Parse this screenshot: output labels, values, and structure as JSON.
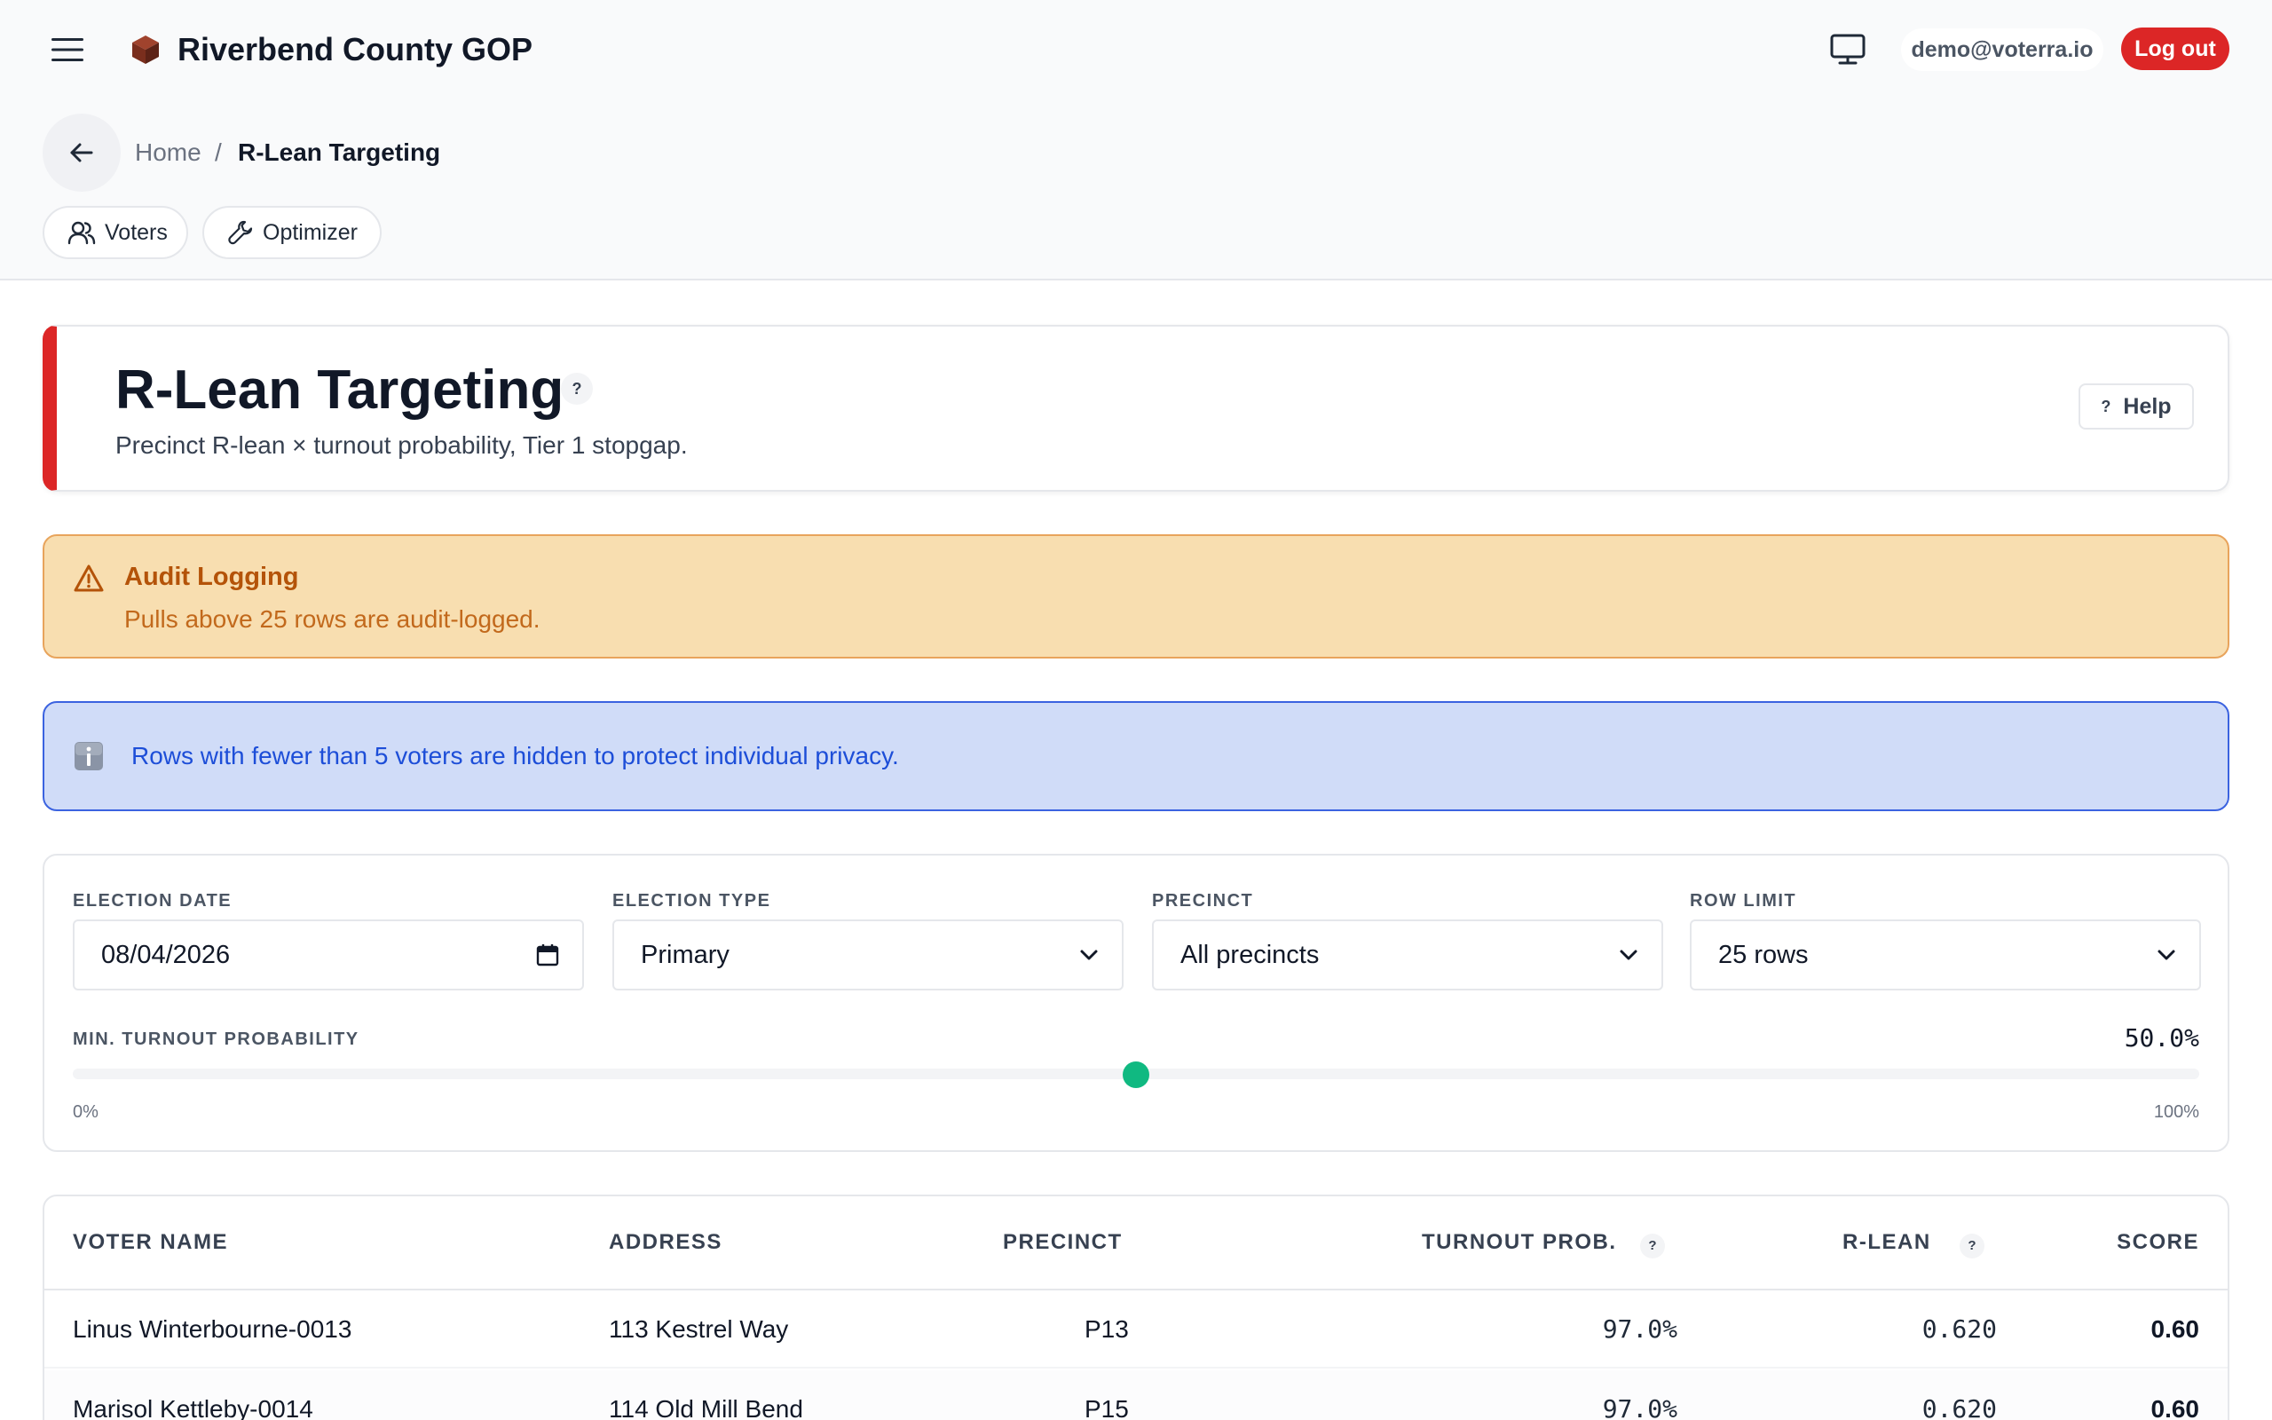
{
  "header": {
    "org_title": "Riverbend County GOP",
    "user_email": "demo@voterra.io",
    "logout_label": "Log out"
  },
  "breadcrumb": {
    "home": "Home",
    "separator": "/",
    "current": "R-Lean Targeting"
  },
  "nav_pills": [
    {
      "label": "Voters",
      "icon": "users-icon"
    },
    {
      "label": "Optimizer",
      "icon": "wrench-icon"
    }
  ],
  "page": {
    "title": "R-Lean Targeting",
    "subtitle": "Precinct R-lean × turnout probability, Tier 1 stopgap.",
    "help_label": "Help",
    "help_glyph": "?"
  },
  "audit_alert": {
    "title": "Audit Logging",
    "text": "Pulls above 25 rows are audit-logged."
  },
  "privacy_notice": {
    "text": "Rows with fewer than 5 voters are hidden to protect individual privacy."
  },
  "filters": {
    "election_date": {
      "label": "ELECTION DATE",
      "value": "08/04/2026"
    },
    "election_type": {
      "label": "ELECTION TYPE",
      "value": "Primary"
    },
    "precinct": {
      "label": "PRECINCT",
      "value": "All precincts"
    },
    "row_limit": {
      "label": "ROW LIMIT",
      "value": "25 rows"
    },
    "min_turnout": {
      "label": "MIN. TURNOUT PROBABILITY",
      "value_text": "50.0%",
      "value_fraction": 0.5,
      "min_label": "0%",
      "max_label": "100%"
    }
  },
  "table": {
    "columns": {
      "voter_name": "VOTER NAME",
      "address": "ADDRESS",
      "precinct": "PRECINCT",
      "turnout": "TURNOUT PROB.",
      "rlean": "R-LEAN",
      "score": "SCORE"
    },
    "rows": [
      {
        "name": "Linus Winterbourne-0013",
        "address": "113 Kestrel Way",
        "precinct": "P13",
        "turnout": "97.0%",
        "rlean": "0.620",
        "score": "0.60"
      },
      {
        "name": "Marisol Kettleby-0014",
        "address": "114 Old Mill Bend",
        "precinct": "P15",
        "turnout": "97.0%",
        "rlean": "0.620",
        "score": "0.60"
      }
    ]
  },
  "colors": {
    "brand_red": "#dc2626",
    "slider_thumb": "#10b981",
    "warning_bg": "#f8deb0",
    "info_bg": "#d0dcf8"
  }
}
